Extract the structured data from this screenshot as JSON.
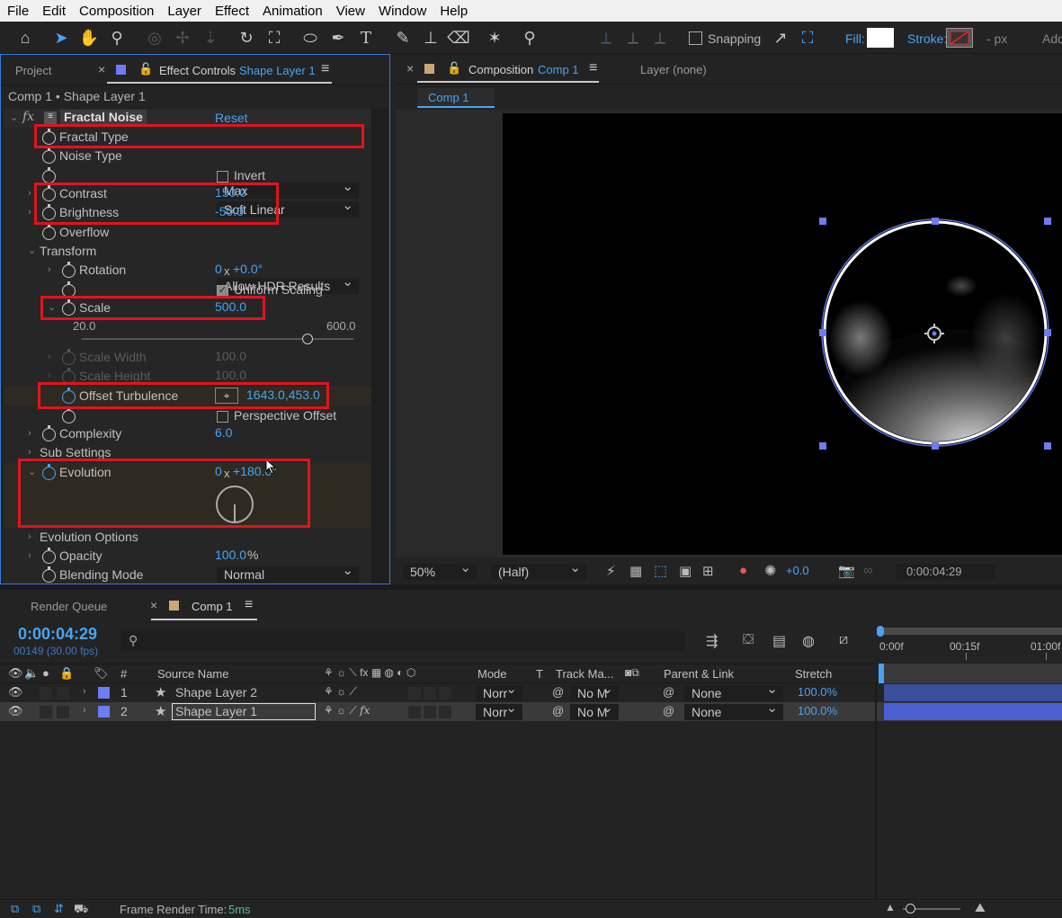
{
  "menu": [
    "File",
    "Edit",
    "Composition",
    "Layer",
    "Effect",
    "Animation",
    "View",
    "Window",
    "Help"
  ],
  "toolbar": {
    "snapping_label": "Snapping",
    "fill_label": "Fill:",
    "stroke_label": "Stroke:",
    "px_label": "- px",
    "add_label": "Add"
  },
  "left_panel": {
    "project_tab": "Project",
    "effect_controls_tab": "Effect Controls",
    "effect_controls_layer": "Shape Layer 1",
    "breadcrumb": "Comp 1 • Shape Layer 1",
    "effect": {
      "fx_label": "fx",
      "name": "Fractal Noise",
      "reset_label": "Reset"
    },
    "props": {
      "fractal_type": {
        "label": "Fractal Type",
        "value": "Max"
      },
      "noise_type": {
        "label": "Noise Type",
        "value": "Soft Linear"
      },
      "invert": {
        "label": "Invert"
      },
      "contrast": {
        "label": "Contrast",
        "value": "150.0"
      },
      "brightness": {
        "label": "Brightness",
        "value": "-50.0"
      },
      "overflow": {
        "label": "Overflow",
        "value": "Allow HDR Results"
      },
      "transform": {
        "label": "Transform"
      },
      "rotation": {
        "label": "Rotation",
        "rev": "0",
        "x": "x",
        "value": "+0.0°"
      },
      "uniform_scaling": {
        "label": "Uniform Scaling"
      },
      "scale": {
        "label": "Scale",
        "value": "500.0",
        "slider_min": "20.0",
        "slider_max": "600.0",
        "slider_fraction": 0.83
      },
      "scale_width": {
        "label": "Scale Width",
        "value": "100.0"
      },
      "scale_height": {
        "label": "Scale Height",
        "value": "100.0"
      },
      "offset_turbulence": {
        "label": "Offset Turbulence",
        "value": "1643.0,453.0"
      },
      "perspective_offset": {
        "label": "Perspective Offset"
      },
      "complexity": {
        "label": "Complexity",
        "value": "6.0"
      },
      "sub_settings": {
        "label": "Sub Settings"
      },
      "evolution": {
        "label": "Evolution",
        "rev": "0",
        "x": "x",
        "value": "+180.0°"
      },
      "evolution_options": {
        "label": "Evolution Options"
      },
      "opacity": {
        "label": "Opacity",
        "value": "100.0",
        "unit": "%"
      },
      "blending_mode": {
        "label": "Blending Mode",
        "value": "Normal"
      }
    }
  },
  "comp_panel": {
    "tab_label": "Composition",
    "comp_name": "Comp 1",
    "layer_tab": "Layer (none)",
    "sub_tab": "Comp 1",
    "zoom": "50%",
    "resolution": "(Half)",
    "exposure": "+0.0",
    "timecode": "0:00:04:29"
  },
  "timeline": {
    "render_queue_tab": "Render Queue",
    "comp_tab": "Comp 1",
    "current_time": "0:00:04:29",
    "frame_info": "00149 (30.00 fps)",
    "search_placeholder": "",
    "headers": {
      "number": "#",
      "source_name": "Source Name",
      "mode": "Mode",
      "t": "T",
      "track_matte": "Track Ma...",
      "parent_link": "Parent & Link",
      "stretch": "Stretch"
    },
    "ruler": [
      "0:00f",
      "00:15f",
      "01:00f"
    ],
    "layers": [
      {
        "num": "1",
        "name": "Shape Layer 2",
        "mode": "Norr",
        "track": "No M",
        "parent": "None",
        "stretch": "100.0%"
      },
      {
        "num": "2",
        "name": "Shape Layer 1",
        "mode": "Norr",
        "track": "No M",
        "parent": "None",
        "stretch": "100.0%"
      }
    ],
    "status_label": "Frame Render Time:",
    "status_value": "5ms"
  },
  "colors": {
    "accent_blue": "#4aa3f0",
    "highlight_red": "#e0141e",
    "label_swatch": "#6d7cf0"
  }
}
